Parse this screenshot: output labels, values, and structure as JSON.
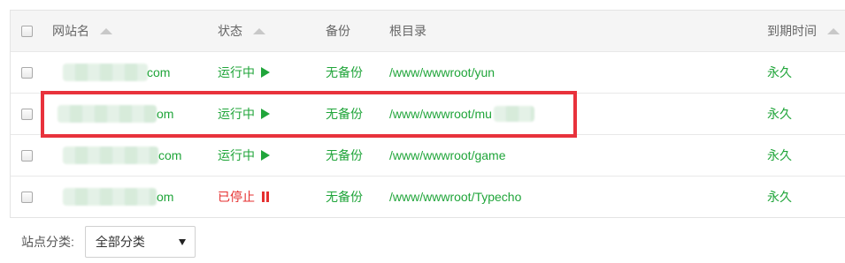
{
  "table": {
    "headers": {
      "name": "网站名",
      "status": "状态",
      "backup": "备份",
      "root": "根目录",
      "expire": "到期时间"
    },
    "rows": [
      {
        "name_suffix": "com",
        "status": "运行中",
        "status_icon": "play-icon",
        "backup": "无备份",
        "root": "/www/wwwroot/yun",
        "expire": "永久"
      },
      {
        "name_suffix": "om",
        "status": "运行中",
        "status_icon": "play-icon",
        "backup": "无备份",
        "root": "/www/wwwroot/mu",
        "expire": "永久"
      },
      {
        "name_suffix": "com",
        "status": "运行中",
        "status_icon": "play-icon",
        "backup": "无备份",
        "root": "/www/wwwroot/game",
        "expire": "永久"
      },
      {
        "name_suffix": "om",
        "status": "已停止",
        "status_icon": "pause-icon",
        "backup": "无备份",
        "root": "/www/wwwroot/Typecho",
        "expire": "永久"
      }
    ]
  },
  "footer": {
    "category_label": "站点分类:",
    "category_selected": "全部分类"
  },
  "colors": {
    "running": "#20a53a",
    "stopped": "#e52f2f",
    "highlight": "#e8323c"
  }
}
